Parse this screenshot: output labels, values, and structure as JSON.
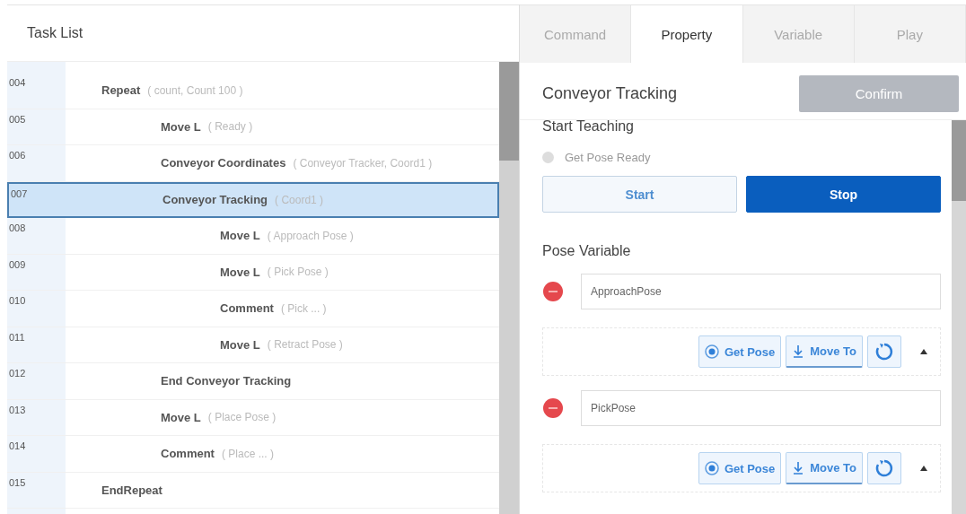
{
  "task_list": {
    "title": "Task List",
    "rows": [
      {
        "number": "004",
        "name": "Repeat",
        "args": "( count, Count 100 )",
        "selected": false,
        "children": [
          {
            "number": "005",
            "name": "Move L",
            "args": "( Ready )",
            "selected": false
          },
          {
            "number": "006",
            "name": "Conveyor Coordinates",
            "args": "( Conveyor Tracker, Coord1 )",
            "selected": false
          },
          {
            "number": "007",
            "name": "Conveyor Tracking",
            "args": "( Coord1 )",
            "selected": true,
            "children": [
              {
                "number": "008",
                "name": "Move L",
                "args": "( Approach Pose )",
                "selected": false
              },
              {
                "number": "009",
                "name": "Move L",
                "args": "( Pick Pose )",
                "selected": false
              },
              {
                "number": "010",
                "name": "Comment",
                "args": "( Pick ... )",
                "selected": false
              },
              {
                "number": "011",
                "name": "Move L",
                "args": "( Retract Pose )",
                "selected": false
              }
            ]
          },
          {
            "number": "012",
            "name": "End Conveyor Tracking",
            "selected": false
          },
          {
            "number": "013",
            "name": "Move L",
            "args": "( Place Pose )",
            "selected": false
          },
          {
            "number": "014",
            "name": "Comment",
            "args": "( Place ... )",
            "selected": false
          }
        ]
      },
      {
        "number": "015",
        "name": "EndRepeat",
        "selected": false
      }
    ]
  },
  "tabs": [
    {
      "label": "Command",
      "selected": false
    },
    {
      "label": "Property",
      "selected": true
    },
    {
      "label": "Variable",
      "selected": false
    },
    {
      "label": "Play",
      "selected": false
    }
  ],
  "property": {
    "title": "Conveyor Tracking",
    "confirm": {
      "label": "Confirm",
      "disabled": true
    },
    "section_title": "Start Teaching",
    "radio": {
      "label": "Get Pose Ready",
      "checked": false
    },
    "teach_buttons": [
      {
        "label": "Start",
        "selected": false
      },
      {
        "label": "Stop",
        "selected": true
      }
    ],
    "pose_title": "Pose Variable",
    "poses": [
      {
        "value": "ApproachPose",
        "get_pose": "Get Pose",
        "move_to": "Move To",
        "expanded": true
      },
      {
        "value": "PickPose",
        "get_pose": "Get Pose",
        "move_to": "Move To",
        "expanded": true
      }
    ]
  }
}
